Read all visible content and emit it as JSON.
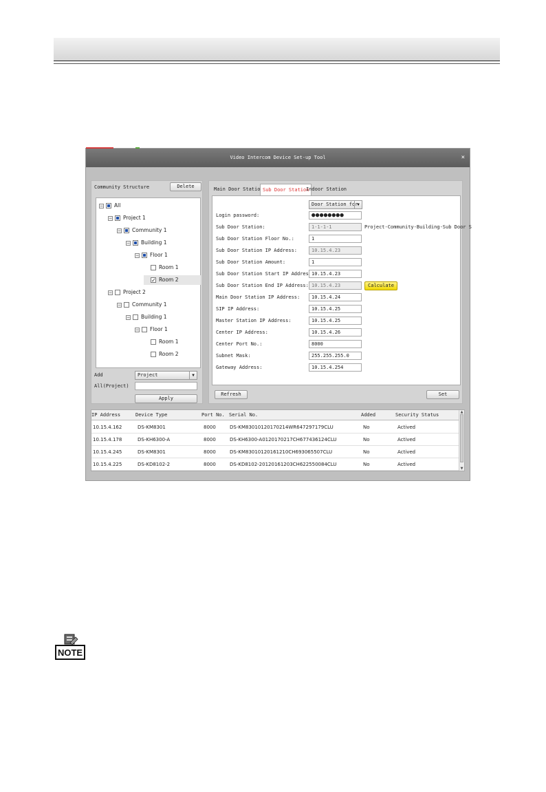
{
  "window": {
    "title": "Video Intercom Device Set-up Tool",
    "close_glyph": "×"
  },
  "left_panel": {
    "label": "Community Structure",
    "delete_label": "Delete",
    "tree": [
      {
        "label": "All",
        "state": "partial",
        "toggle": "−",
        "level": 0
      },
      {
        "label": "Project 1",
        "state": "partial",
        "toggle": "−",
        "level": 1
      },
      {
        "label": "Community 1",
        "state": "partial",
        "toggle": "−",
        "level": 2
      },
      {
        "label": "Building 1",
        "state": "partial",
        "toggle": "−",
        "level": 3
      },
      {
        "label": "Floor 1",
        "state": "partial",
        "toggle": "−",
        "level": 4
      },
      {
        "label": "Room 1",
        "state": "unchecked",
        "toggle": "",
        "level": 5
      },
      {
        "label": "Room 2",
        "state": "checked",
        "toggle": "",
        "level": 5,
        "selected": true
      },
      {
        "label": "Project 2",
        "state": "unchecked",
        "toggle": "−",
        "level": 1
      },
      {
        "label": "Community 1",
        "state": "unchecked",
        "toggle": "−",
        "level": 2
      },
      {
        "label": "Building 1",
        "state": "unchecked",
        "toggle": "−",
        "level": 3
      },
      {
        "label": "Floor 1",
        "state": "unchecked",
        "toggle": "−",
        "level": 4
      },
      {
        "label": "Room 1",
        "state": "unchecked",
        "toggle": "",
        "level": 5
      },
      {
        "label": "Room 2",
        "state": "unchecked",
        "toggle": "",
        "level": 5
      }
    ],
    "add_label": "Add",
    "add_value": "Project",
    "all_label": "All(Project)",
    "all_value": "",
    "apply_label": "Apply"
  },
  "tabs": [
    "Main Door Station",
    "Sub Door Station",
    "Indoor Station"
  ],
  "active_tab": "Sub Door Station",
  "form": {
    "device_type_value": "Door Station for",
    "rows": [
      {
        "label": "Login password:",
        "value": "●●●●●●●●",
        "kind": "password"
      },
      {
        "label": "Sub Door Station:",
        "value": "1-1-1-1",
        "kind": "readonly",
        "hint": "Project-Community-Building-Sub Door S"
      },
      {
        "label": "Sub Door Station Floor No.:",
        "value": "1",
        "kind": "text"
      },
      {
        "label": "Sub Door Station IP Address:",
        "value": "10.15.4.23",
        "kind": "readonly"
      },
      {
        "label": "Sub Door Station Amount:",
        "value": "1",
        "kind": "text"
      },
      {
        "label": "Sub Door Station Start IP Address:",
        "value": "10.15.4.23",
        "kind": "text"
      },
      {
        "label": "Sub Door Station End IP Address:",
        "value": "10.15.4.23",
        "kind": "readonly"
      },
      {
        "label": "Main Door Station IP Address:",
        "value": "10.15.4.24",
        "kind": "text"
      },
      {
        "label": "SIP IP Address:",
        "value": "10.15.4.25",
        "kind": "text"
      },
      {
        "label": "Master Station IP Address:",
        "value": "10.15.4.25",
        "kind": "text"
      },
      {
        "label": "Center IP Address:",
        "value": "10.15.4.26",
        "kind": "text"
      },
      {
        "label": "Center Port No.:",
        "value": "8000",
        "kind": "text"
      },
      {
        "label": "Subnet Mask:",
        "value": "255.255.255.0",
        "kind": "text"
      },
      {
        "label": "Gateway Address:",
        "value": "10.15.4.254",
        "kind": "text"
      }
    ],
    "calculate_label": "Calculate",
    "refresh_label": "Refresh",
    "set_label": "Set"
  },
  "device_list": {
    "columns": [
      "IP Address",
      "Device Type",
      "Port No.",
      "Serial No.",
      "Added",
      "Security Status"
    ],
    "rows": [
      [
        "10.15.4.162",
        "DS-KM8301",
        "8000",
        "DS-KM8301012017021​4WR647297179CLU",
        "No",
        "Actived"
      ],
      [
        "10.15.4.178",
        "DS-KH6300-A",
        "8000",
        "DS-KH6300-A0120170217CH677436124CLU",
        "No",
        "Actived"
      ],
      [
        "10.15.4.245",
        "DS-KM8301",
        "8000",
        "DS-KM83010120161210CH693065507CLU",
        "No",
        "Actived"
      ],
      [
        "10.15.4.225",
        "DS-KD8102-2",
        "8000",
        "DS-KD8102-20120161203CH622550084CLU",
        "No",
        "Actived"
      ]
    ]
  },
  "note": {
    "label": "NOTE"
  },
  "colors": {
    "titlebar": "#5b5b5b",
    "active_tab_text": "#dd3333",
    "calculate": "#f0d800",
    "tree_partial": "#1f4fa8"
  }
}
